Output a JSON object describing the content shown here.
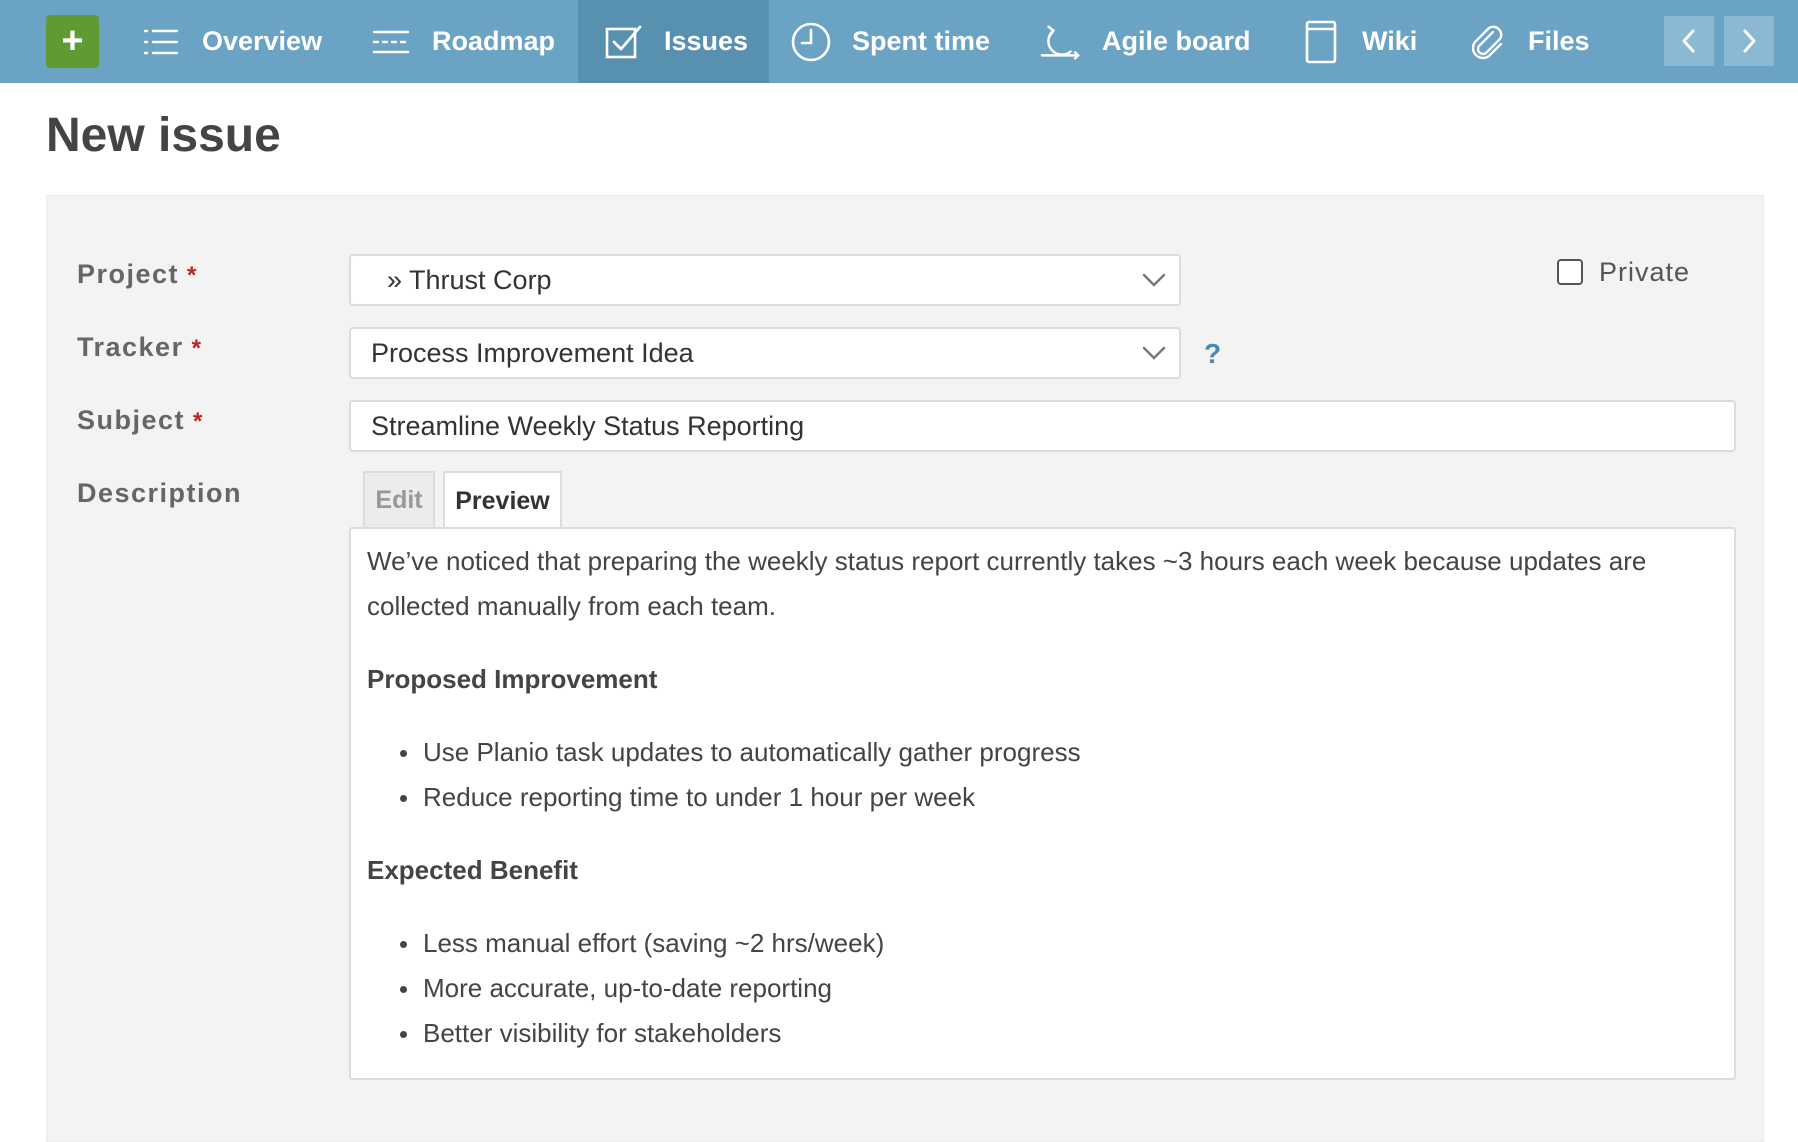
{
  "nav": {
    "add_label": "+",
    "items": [
      {
        "label": "Overview",
        "icon": "list-icon"
      },
      {
        "label": "Roadmap",
        "icon": "roadmap-icon"
      },
      {
        "label": "Issues",
        "icon": "checkbox-icon",
        "active": true
      },
      {
        "label": "Spent time",
        "icon": "clock-icon"
      },
      {
        "label": "Agile board",
        "icon": "refresh-icon"
      },
      {
        "label": "Wiki",
        "icon": "page-icon"
      },
      {
        "label": "Files",
        "icon": "paperclip-icon"
      }
    ],
    "colors": {
      "bar": "#6ba3c4",
      "active": "#5890b0",
      "add_button": "#5f9a32"
    }
  },
  "page": {
    "title": "New issue"
  },
  "form": {
    "project": {
      "label": "Project",
      "required_mark": "*",
      "value": "» Thrust Corp"
    },
    "private": {
      "label": "Private",
      "checked": false
    },
    "tracker": {
      "label": "Tracker",
      "required_mark": "*",
      "value": "Process Improvement Idea",
      "help": "?"
    },
    "subject": {
      "label": "Subject",
      "required_mark": "*",
      "value": "Streamline Weekly Status Reporting"
    },
    "description": {
      "label": "Description",
      "tabs": {
        "edit": "Edit",
        "preview": "Preview",
        "active": "Preview"
      },
      "intro": "We’ve noticed that preparing the weekly status report currently takes ~3 hours each week because updates are collected manually from each team.",
      "section1": {
        "heading": "Proposed Improvement",
        "items": [
          "Use Planio task updates to automatically gather progress",
          "Reduce reporting time to under 1 hour per week"
        ]
      },
      "section2": {
        "heading": "Expected Benefit",
        "items": [
          "Less manual effort (saving ~2 hrs/week)",
          "More accurate, up-to-date reporting",
          "Better visibility for stakeholders"
        ]
      }
    }
  }
}
